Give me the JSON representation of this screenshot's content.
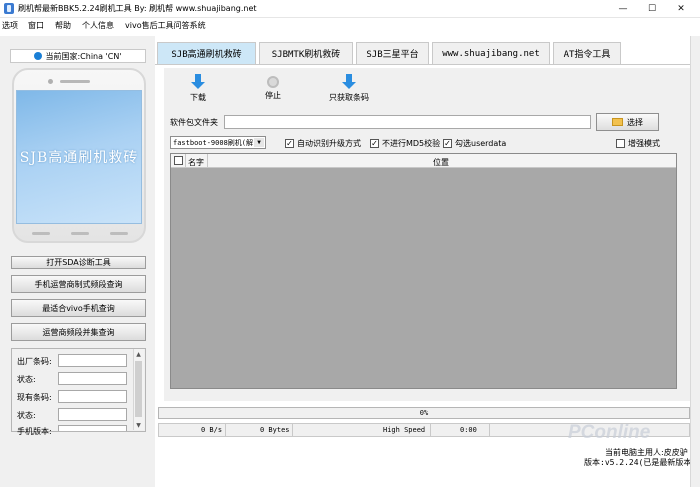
{
  "window": {
    "title": "刷机帮最新BBK5.2.24刷机工具 By: 刷机帮 www.shuajibang.net",
    "minimize": "—",
    "maximize": "☐",
    "close": "✕"
  },
  "menu": [
    "选项",
    "窗口",
    "帮助",
    "个人信息",
    "vivo售后工具问答系统"
  ],
  "country": "当前国家:China 'CN'",
  "phone_screen_text": "SJB高通刷机救砖",
  "left_buttons": [
    "打开SDA诊断工具",
    "手机运营商制式频段查询",
    "最适合vivo手机查询",
    "运营商频段并集查询"
  ],
  "info_fields": [
    "出厂条码:",
    "状态:",
    "现有条码:",
    "状态:",
    "手机版本:"
  ],
  "tabs": [
    "SJB高通刷机救砖",
    "SJBMTK刷机救砖",
    "SJB三星平台",
    "www.shuajibang.net",
    "AT指令工具"
  ],
  "toolbar": {
    "download": "下载",
    "stop": "停止",
    "fetch_barcode": "只获取条码"
  },
  "folder_label": "软件包文件夹",
  "folder_value": "",
  "select_button": "选择",
  "mode_select": "fastboot-9008刷机(解",
  "checkboxes": [
    {
      "label": "自动识别升级方式",
      "checked": true
    },
    {
      "label": "不进行MD5校验",
      "checked": true
    },
    {
      "label": "勾选userdata",
      "checked": true
    },
    {
      "label": "增强模式",
      "checked": false
    }
  ],
  "grid": {
    "columns": [
      "名字",
      "位置"
    ]
  },
  "progress": {
    "text": "0%",
    "value": 0
  },
  "status": {
    "speed": "0 B/s",
    "bytes": "0 Bytes",
    "mode": "High Speed",
    "time": "0:00"
  },
  "footer": {
    "user": "当前电脑主用人:皮皮驴",
    "version": "版本:v5.2.24(已是最新版本)"
  },
  "watermark": "PConline"
}
